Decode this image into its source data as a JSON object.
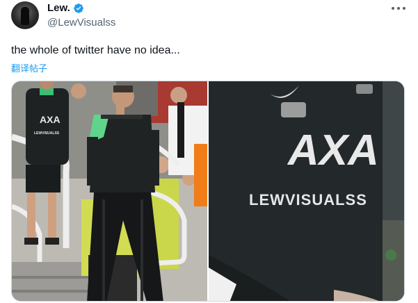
{
  "author": {
    "display_name": "Lew.",
    "handle": "@LewVisualss",
    "verified": true
  },
  "tweet": {
    "text": "the whole of twitter have no idea...",
    "translate_label": "翻译帖子"
  },
  "media": {
    "photos": [
      {
        "sponsor_text": "AXA",
        "shirt_text": "LEWVISUALSS"
      },
      {
        "sponsor_text": "AXA",
        "shirt_text": "LEWVISUALSS"
      }
    ]
  },
  "icons": {
    "verified": "verified-badge-icon",
    "more": "more-options-icon"
  },
  "colors": {
    "accent": "#1d9bf0",
    "text_primary": "#0f1419",
    "text_secondary": "#536471",
    "kit_accent": "#3ddc84"
  }
}
